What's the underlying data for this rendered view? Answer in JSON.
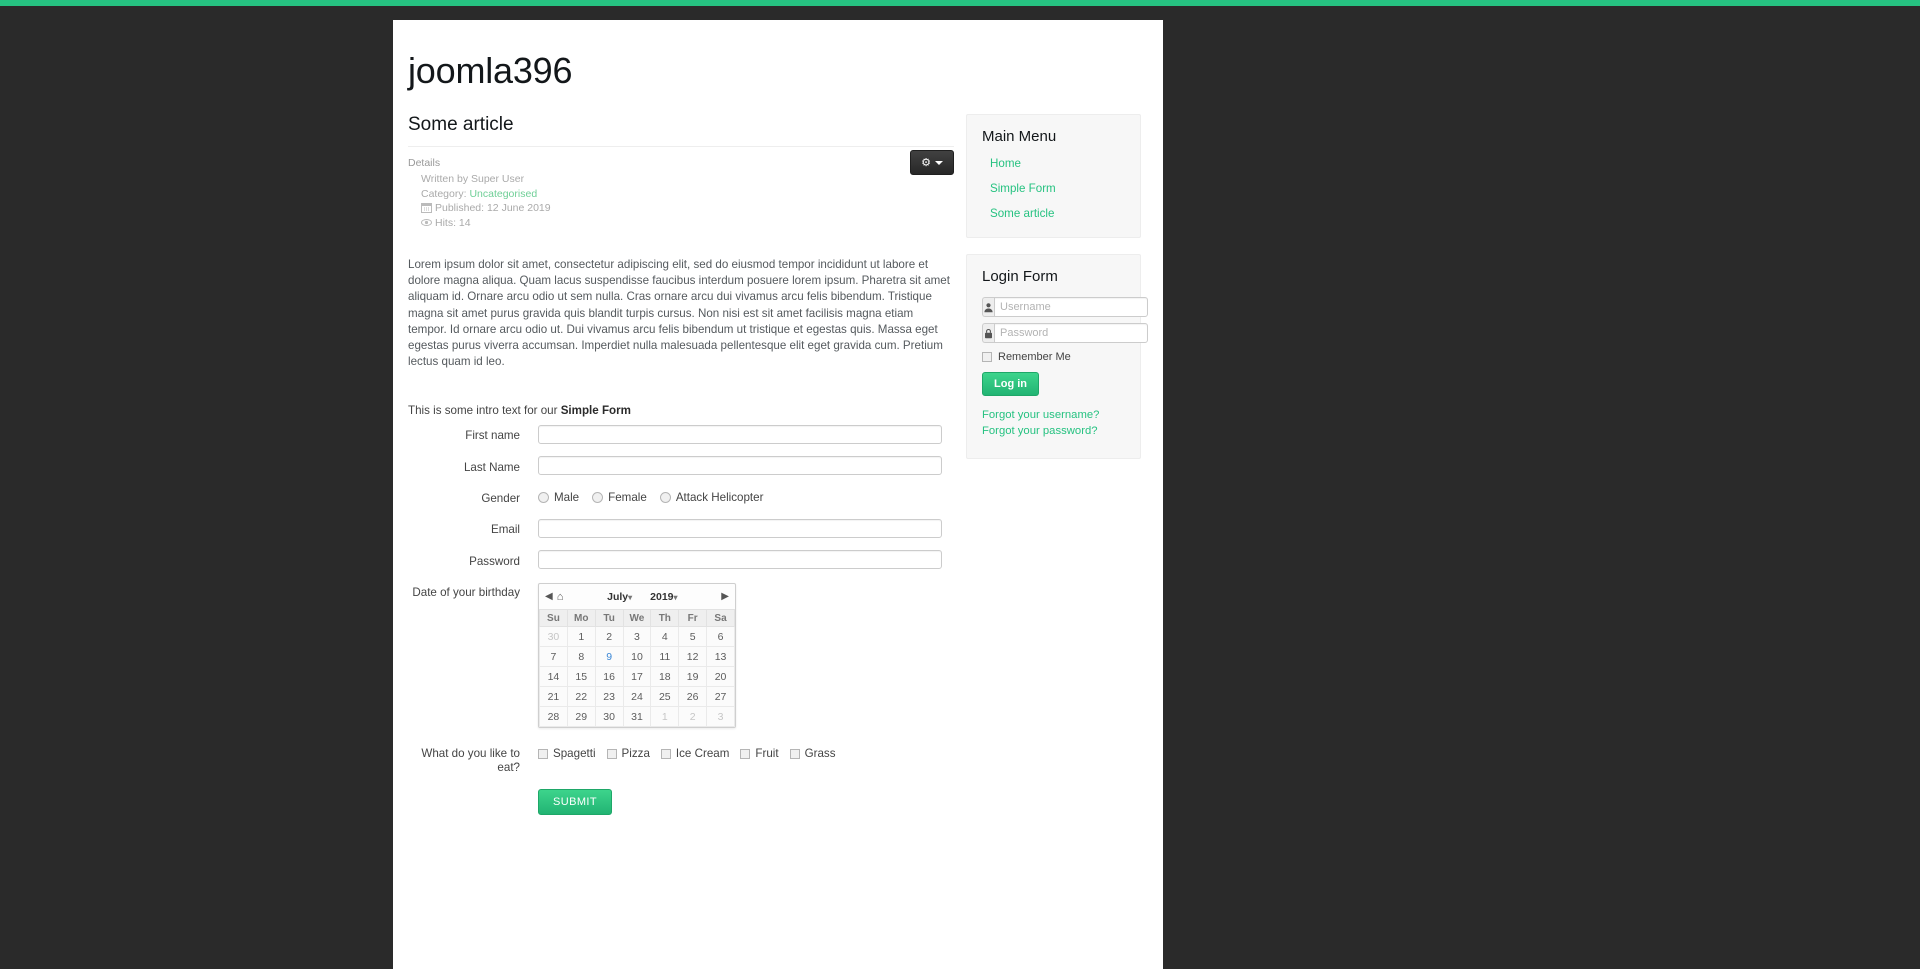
{
  "site": {
    "title": "joomla396",
    "accent_color": "#26c281",
    "link_color": "#26c281",
    "top_strip_color": "#26c281",
    "page_background": "#2a2a2a"
  },
  "article": {
    "title": "Some article",
    "details_heading": "Details",
    "written_by": "Written by Super User",
    "category_label": "Category:",
    "category_value": "Uncategorised",
    "published_label": "Published:",
    "published_value": "12 June 2019",
    "hits_label": "Hits:",
    "hits_value": "14",
    "published_icon": "calendar-icon",
    "hits_icon": "eye-icon",
    "actions_icon": "gear-icon",
    "actions_caret_icon": "caret-down-icon",
    "body": "Lorem ipsum dolor sit amet, consectetur adipiscing elit, sed do eiusmod tempor incididunt ut labore et dolore magna aliqua. Quam lacus suspendisse faucibus interdum posuere lorem ipsum. Pharetra sit amet aliquam id. Ornare arcu odio ut sem nulla. Cras ornare arcu dui vivamus arcu felis bibendum. Tristique magna sit amet purus gravida quis blandit turpis cursus. Non nisi est sit amet facilisis magna etiam tempor. Id ornare arcu odio ut. Dui vivamus arcu felis bibendum ut tristique et egestas quis. Massa eget egestas purus viverra accumsan. Imperdiet nulla malesuada pellentesque elit eget gravida cum. Pretium lectus quam id leo."
  },
  "form": {
    "intro_prefix": "This is some intro text for our ",
    "intro_bold": "Simple Form",
    "fields": {
      "first_name_label": "First name",
      "first_name_value": "",
      "last_name_label": "Last Name",
      "last_name_value": "",
      "gender_label": "Gender",
      "gender_options": [
        "Male",
        "Female",
        "Attack Helicopter"
      ],
      "gender_selected": "",
      "email_label": "Email",
      "email_value": "",
      "password_label": "Password",
      "password_value": "",
      "birthday_label": "Date of your birthday",
      "eat_label": "What do you like to eat?",
      "eat_options": [
        "Spagetti",
        "Pizza",
        "Ice Cream",
        "Fruit",
        "Grass"
      ],
      "eat_selected": []
    },
    "submit_label": "SUBMIT"
  },
  "calendar": {
    "prev_icon": "triangle-left-icon",
    "home_icon": "home-icon",
    "next_icon": "triangle-right-icon",
    "month": "July",
    "year": "2019",
    "month_caret_icon": "caret-down-icon",
    "year_caret_icon": "caret-down-icon",
    "weekdays": [
      "Su",
      "Mo",
      "Tu",
      "We",
      "Th",
      "Fr",
      "Sa"
    ],
    "today": 9,
    "weeks": [
      [
        {
          "d": "30",
          "m": "prev"
        },
        {
          "d": "1",
          "m": "cur"
        },
        {
          "d": "2",
          "m": "cur"
        },
        {
          "d": "3",
          "m": "cur"
        },
        {
          "d": "4",
          "m": "cur"
        },
        {
          "d": "5",
          "m": "cur"
        },
        {
          "d": "6",
          "m": "cur"
        }
      ],
      [
        {
          "d": "7",
          "m": "cur"
        },
        {
          "d": "8",
          "m": "cur"
        },
        {
          "d": "9",
          "m": "today"
        },
        {
          "d": "10",
          "m": "cur"
        },
        {
          "d": "11",
          "m": "cur"
        },
        {
          "d": "12",
          "m": "cur"
        },
        {
          "d": "13",
          "m": "cur"
        }
      ],
      [
        {
          "d": "14",
          "m": "cur"
        },
        {
          "d": "15",
          "m": "cur"
        },
        {
          "d": "16",
          "m": "cur"
        },
        {
          "d": "17",
          "m": "cur"
        },
        {
          "d": "18",
          "m": "cur"
        },
        {
          "d": "19",
          "m": "cur"
        },
        {
          "d": "20",
          "m": "cur"
        }
      ],
      [
        {
          "d": "21",
          "m": "cur"
        },
        {
          "d": "22",
          "m": "cur"
        },
        {
          "d": "23",
          "m": "cur"
        },
        {
          "d": "24",
          "m": "cur"
        },
        {
          "d": "25",
          "m": "cur"
        },
        {
          "d": "26",
          "m": "cur"
        },
        {
          "d": "27",
          "m": "cur"
        }
      ],
      [
        {
          "d": "28",
          "m": "cur"
        },
        {
          "d": "29",
          "m": "cur"
        },
        {
          "d": "30",
          "m": "cur"
        },
        {
          "d": "31",
          "m": "cur"
        },
        {
          "d": "1",
          "m": "next"
        },
        {
          "d": "2",
          "m": "next"
        },
        {
          "d": "3",
          "m": "next"
        }
      ]
    ]
  },
  "main_menu": {
    "title": "Main Menu",
    "items": [
      {
        "label": "Home"
      },
      {
        "label": "Simple Form"
      },
      {
        "label": "Some article"
      }
    ]
  },
  "login_form": {
    "title": "Login Form",
    "username_placeholder": "Username",
    "username_value": "",
    "username_icon": "user-icon",
    "password_placeholder": "Password",
    "password_value": "",
    "password_icon": "lock-icon",
    "remember_label": "Remember Me",
    "remember_checked": false,
    "login_button": "Log in",
    "forgot_username": "Forgot your username?",
    "forgot_password": "Forgot your password?"
  }
}
